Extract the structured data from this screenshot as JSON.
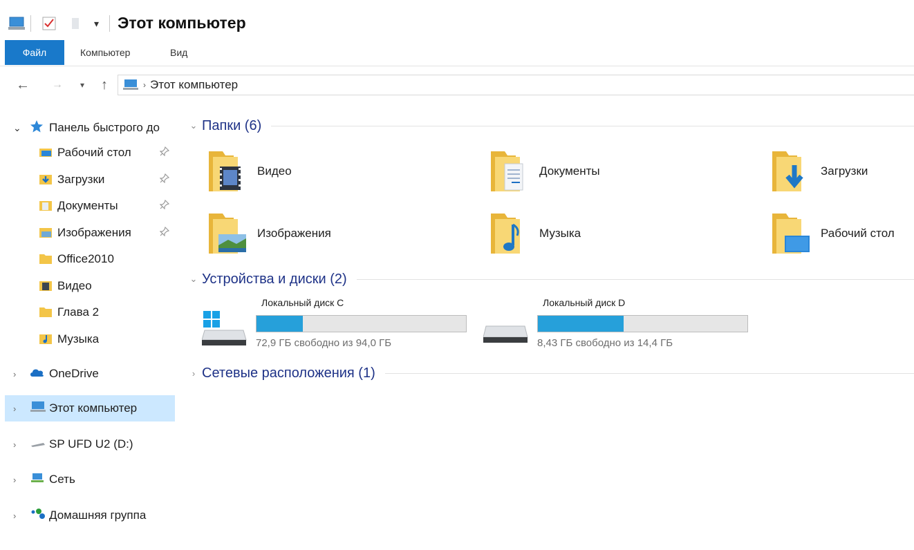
{
  "window": {
    "title": "Этот компьютер"
  },
  "ribbon": {
    "tabs": [
      "Файл",
      "Компьютер",
      "Вид"
    ]
  },
  "address": {
    "path": "Этот компьютер"
  },
  "sidebar": {
    "quick_access": "Панель быстрого до",
    "quick_items": [
      {
        "label": "Рабочий стол",
        "icon": "desktop-icon",
        "pinned": true
      },
      {
        "label": "Загрузки",
        "icon": "downloads-icon",
        "pinned": true
      },
      {
        "label": "Документы",
        "icon": "documents-icon",
        "pinned": true
      },
      {
        "label": "Изображения",
        "icon": "pictures-icon",
        "pinned": true
      },
      {
        "label": "Office2010",
        "icon": "folder-icon",
        "pinned": false
      },
      {
        "label": "Видео",
        "icon": "video-icon",
        "pinned": false
      },
      {
        "label": "Глава 2",
        "icon": "folder-icon",
        "pinned": false
      },
      {
        "label": "Музыка",
        "icon": "music-icon",
        "pinned": false
      }
    ],
    "onedrive": "OneDrive",
    "this_pc": "Этот компьютер",
    "usb": "SP UFD U2 (D:)",
    "network": "Сеть",
    "homegroup": "Домашняя группа"
  },
  "main": {
    "folders_header": "Папки (6)",
    "folders": [
      {
        "label": "Видео",
        "icon": "video-folder-icon"
      },
      {
        "label": "Документы",
        "icon": "documents-folder-icon"
      },
      {
        "label": "Загрузки",
        "icon": "downloads-folder-icon"
      },
      {
        "label": "Изображения",
        "icon": "pictures-folder-icon"
      },
      {
        "label": "Музыка",
        "icon": "music-folder-icon"
      },
      {
        "label": "Рабочий стол",
        "icon": "desktop-folder-icon"
      }
    ],
    "devices_header": "Устройства и диски (2)",
    "drives": [
      {
        "name": "Локальный диск C",
        "free_text": "72,9 ГБ свободно из 94,0 ГБ",
        "used_fraction": 0.22
      },
      {
        "name": "Локальный диск D",
        "free_text": "8,43 ГБ свободно из 14,4 ГБ",
        "used_fraction": 0.41
      }
    ],
    "network_header": "Сетевые расположения (1)"
  },
  "colors": {
    "accent": "#1979ca",
    "selection": "#cce8ff",
    "group_title": "#1e3287",
    "drive_fill": "#26a0da",
    "folder_yellow": "#f8d775"
  }
}
